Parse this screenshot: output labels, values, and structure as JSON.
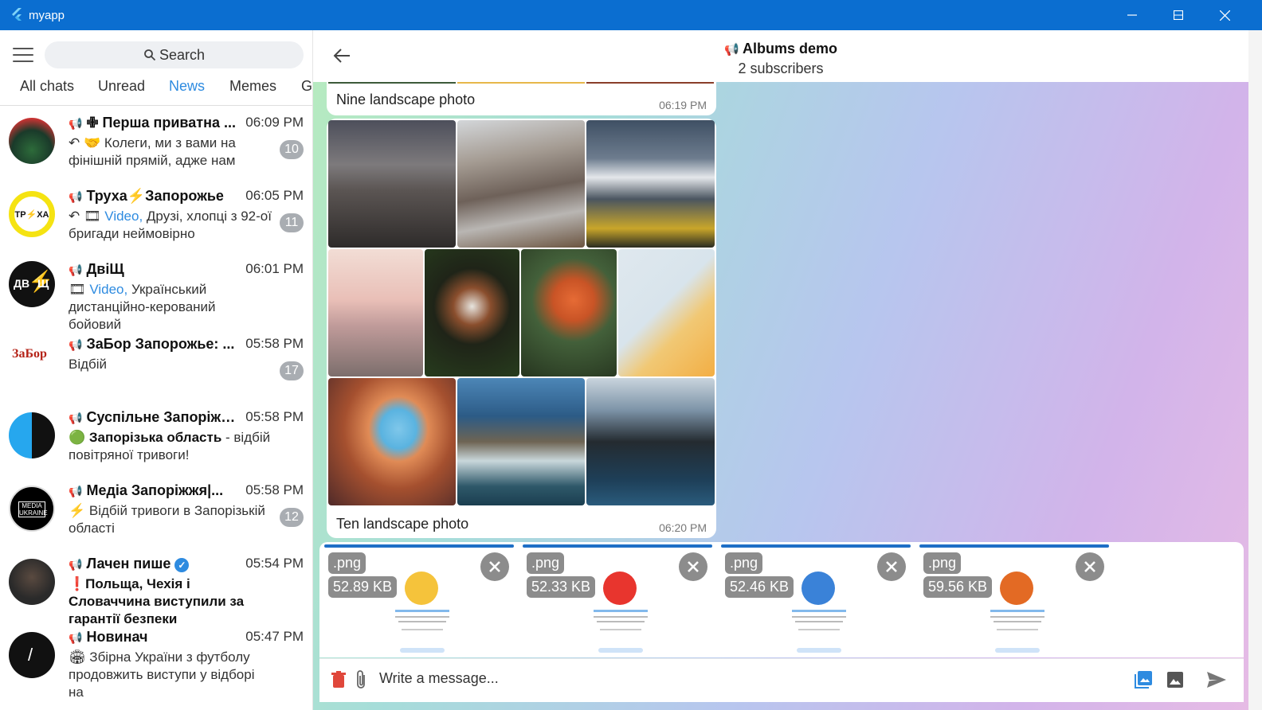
{
  "window": {
    "title": "myapp"
  },
  "sidebar": {
    "search_placeholder": "Search",
    "tabs": [
      "All chats",
      "Unread",
      "News",
      "Memes",
      "G"
    ],
    "chats": [
      {
        "name": "✙ Перша приватна ...",
        "time": "06:09 PM",
        "preview_html": "<span>↶ 🤝 Колеги, ми з вами на фінішній прямій, адже нам</span>",
        "badge": "10"
      },
      {
        "name": "Труха⚡Запорожье",
        "time": "06:05 PM",
        "preview_html": "<span>↶ 🎞 <span class='blue'>Video,</span> Друзі, хлопці з 92-ої бригади неймовірно</span>",
        "badge": "11"
      },
      {
        "name": "ДвіЩ",
        "time": "06:01 PM",
        "preview_html": "<span>🎞 <span class='blue'>Video,</span> Український дистанційно-керований бойовий</span>",
        "badge": ""
      },
      {
        "name": "ЗаБор Запорожье: ...",
        "time": "05:58 PM",
        "preview_html": "<span>Відбій</span>",
        "badge": "17"
      },
      {
        "name": "Суспільне Запоріжж...",
        "time": "05:58 PM",
        "preview_html": "<span>🟢 <b>Запорізька область</b> - відбій повітряної тривоги!</span>",
        "badge": ""
      },
      {
        "name": "Медіа Запоріжжя|...",
        "time": "05:58 PM",
        "preview_html": "<span>⚡ Відбій тривоги в Запорізькій області</span>",
        "badge": "12"
      },
      {
        "name": "Лачен пише",
        "time": "05:54 PM",
        "preview_html": "<span><span style='color:#e0192b'>❗</span><b>Польща, Чехія і Словаччина виступили за гарантії безпеки</b></span>",
        "badge": ""
      },
      {
        "name": "Новинач",
        "time": "05:47 PM",
        "preview_html": "<span>🏟 Збірна України з футболу продовжить виступи у відборі на</span>",
        "badge": ""
      }
    ]
  },
  "header": {
    "title": "Albums demo",
    "subtitle": "2 subscribers"
  },
  "messages": [
    {
      "caption": "Nine landscape photo",
      "time": "06:19 PM"
    },
    {
      "caption": "Ten landscape photo",
      "time": "06:20 PM"
    }
  ],
  "attachments": [
    {
      "ext": ".png",
      "size": "52.89 KB"
    },
    {
      "ext": ".png",
      "size": "52.33 KB"
    },
    {
      "ext": ".png",
      "size": "52.46 KB"
    },
    {
      "ext": ".png",
      "size": "59.56 KB"
    }
  ],
  "composer": {
    "placeholder": "Write a message..."
  },
  "colors": {
    "titlebar": "#0b6ed0",
    "accent": "#2e8be0",
    "badge": "#a9adb2"
  }
}
